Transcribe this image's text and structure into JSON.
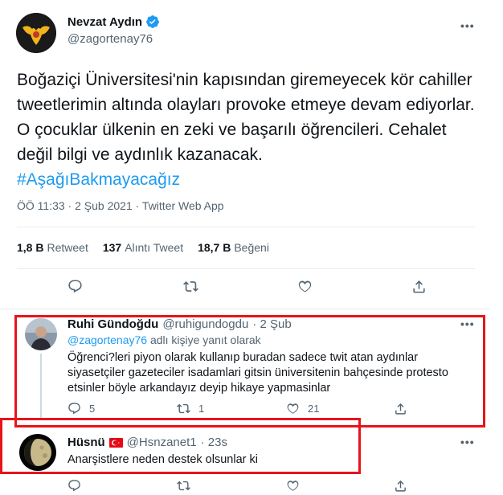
{
  "main_tweet": {
    "author_name": "Nevzat Aydın",
    "author_handle": "@zagortenay76",
    "text": "Boğaziçi Üniversitesi'nin kapısından giremeyecek kör cahiller tweetlerimin altında olayları provoke etmeye devam ediyorlar. O çocuklar ülkenin en zeki ve başarılı öğrencileri. Cehalet değil bilgi ve aydınlık kazanacak.",
    "hashtag": "#AşağıBakmayacağız",
    "meta": "ÖÖ 11:33 · 2 Şub 2021 · Twitter Web App",
    "stats": {
      "retweets_value": "1,8 B",
      "retweets_label": "Retweet",
      "quotes_value": "137",
      "quotes_label": "Alıntı Tweet",
      "likes_value": "18,7 B",
      "likes_label": "Beğeni"
    }
  },
  "replies": [
    {
      "name": "Ruhi Gündoğdu",
      "handle": "@ruhigundogdu",
      "time": "· 2 Şub",
      "reply_to_mention": "@zagortenay76",
      "reply_to_suffix": "adlı kişiye yanıt olarak",
      "text": "Öğrenci?leri piyon olarak kullanıp buradan sadece twit atan aydınlar siyasetçiler gazeteciler isadamlari gitsin üniversitenin bahçesinde protesto etsinler böyle arkandayız deyip hikaye yapmasinlar",
      "replies_count": "5",
      "retweets_count": "1",
      "likes_count": "21"
    },
    {
      "name": "Hüsnü",
      "handle": "@Hsnzanet1",
      "time": "· 23s",
      "text": "Anarşistlere neden destek olsunlar ki"
    }
  ],
  "colors": {
    "accent": "#1d9bf0",
    "highlight_box": "#e8141b",
    "secondary_text": "#536471"
  },
  "icons": [
    "verified-badge-icon",
    "more-icon",
    "reply-icon",
    "retweet-icon",
    "like-icon",
    "share-icon",
    "turkey-flag-icon"
  ]
}
